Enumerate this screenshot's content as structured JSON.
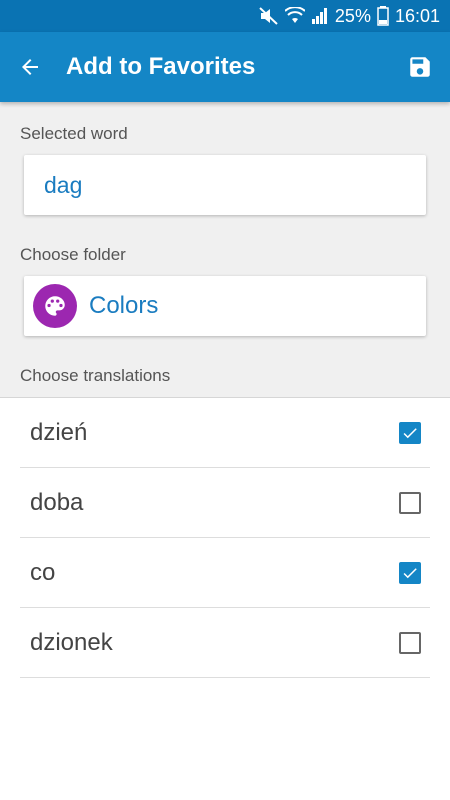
{
  "status_bar": {
    "battery": "25%",
    "time": "16:01",
    "icons": [
      "mute-icon",
      "wifi-icon",
      "signal-icon",
      "battery-icon"
    ]
  },
  "app_bar": {
    "title": "Add to Favorites",
    "back_icon": "arrow-back-icon",
    "save_icon": "save-icon"
  },
  "selected_word": {
    "label": "Selected word",
    "value": "dag"
  },
  "folder": {
    "label": "Choose folder",
    "name": "Colors",
    "icon": "palette-icon",
    "icon_color": "#9c27b0"
  },
  "translations": {
    "label": "Choose translations",
    "items": [
      {
        "text": "dzień",
        "checked": true
      },
      {
        "text": "doba",
        "checked": false
      },
      {
        "text": "co",
        "checked": true
      },
      {
        "text": "dzionek",
        "checked": false
      }
    ]
  },
  "colors": {
    "app_bar": "#1486c6",
    "status_bar": "#0a73b3",
    "accent_text": "#1a7cc0"
  }
}
